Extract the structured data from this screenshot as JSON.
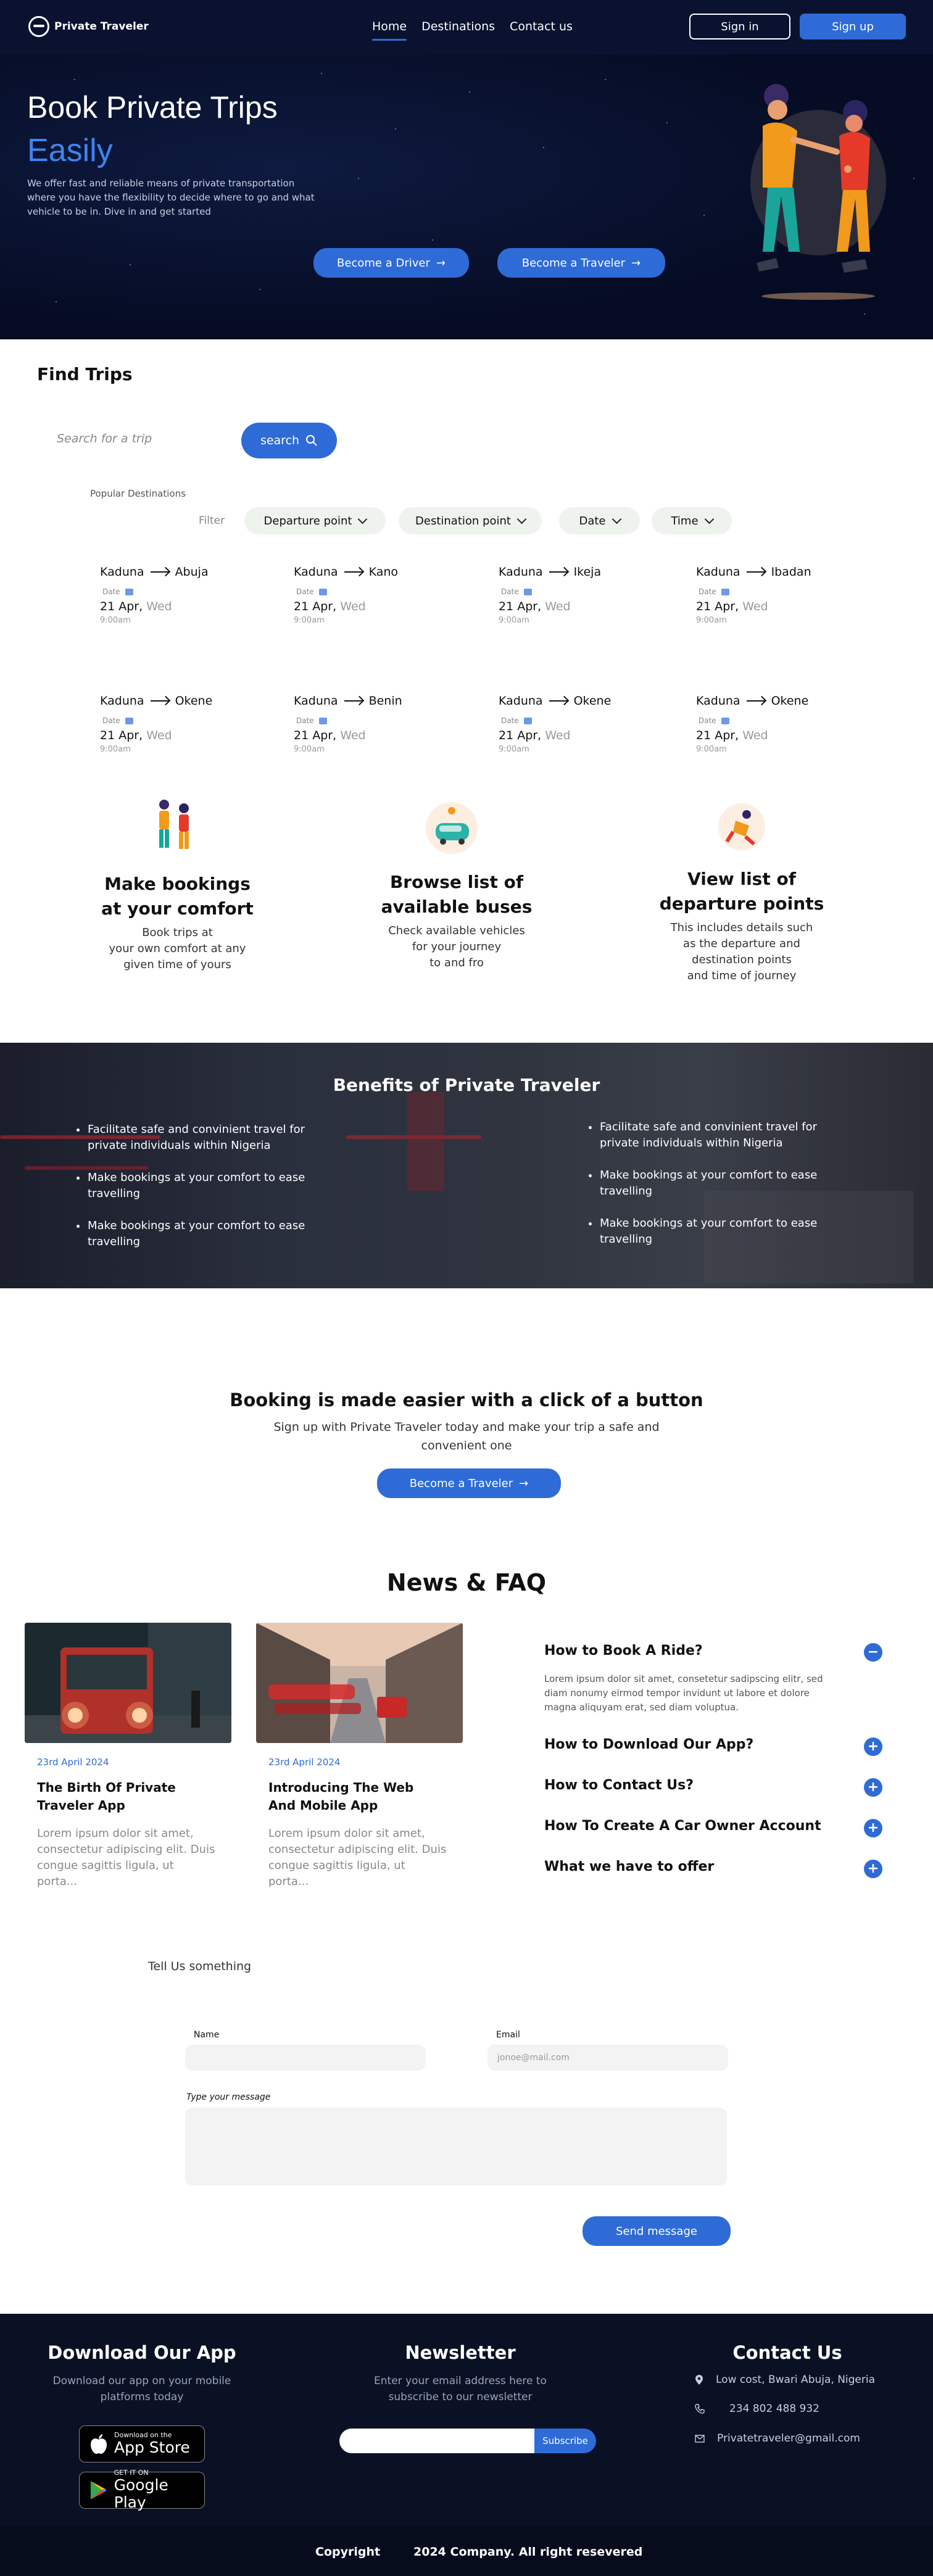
{
  "nav": {
    "brand": "Private Traveler",
    "links": [
      "Home",
      "Destinations",
      "Contact us"
    ],
    "signin": "Sign in",
    "signup": "Sign up"
  },
  "hero": {
    "title": "Book Private Trips",
    "accent": "Easily",
    "description": "We offer fast and reliable means of private transportation where you have the flexibility to decide where to go and what vehicle to be in. Dive in and get started",
    "driver_btn": "Become a Driver",
    "traveler_btn": "Become a Traveler"
  },
  "find": {
    "title": "Find Trips",
    "search_placeholder": "Search for a trip",
    "search_btn": "search",
    "popular": "Popular Destinations",
    "filter_label": "Filter",
    "filters": [
      "Departure point",
      "Destination point",
      "Date",
      "Time"
    ],
    "trips": [
      {
        "from": "Kaduna",
        "to": "Abuja",
        "date_label": "Date",
        "date": "21 Apr,",
        "day": "Wed",
        "time": "9:00am"
      },
      {
        "from": "Kaduna",
        "to": "Kano",
        "date_label": "Date",
        "date": "21 Apr,",
        "day": "Wed",
        "time": "9:00am"
      },
      {
        "from": "Kaduna",
        "to": "Ikeja",
        "date_label": "Date",
        "date": "21 Apr,",
        "day": "Wed",
        "time": "9:00am"
      },
      {
        "from": "Kaduna",
        "to": "Ibadan",
        "date_label": "Date",
        "date": "21 Apr,",
        "day": "Wed",
        "time": "9:00am"
      },
      {
        "from": "Kaduna",
        "to": "Okene",
        "date_label": "Date",
        "date": "21 Apr,",
        "day": "Wed",
        "time": "9:00am"
      },
      {
        "from": "Kaduna",
        "to": "Benin",
        "date_label": "Date",
        "date": "21 Apr,",
        "day": "Wed",
        "time": "9:00am"
      },
      {
        "from": "Kaduna",
        "to": "Okene",
        "date_label": "Date",
        "date": "21 Apr,",
        "day": "Wed",
        "time": "9:00am"
      },
      {
        "from": "Kaduna",
        "to": "Okene",
        "date_label": "Date",
        "date": "21 Apr,",
        "day": "Wed",
        "time": "9:00am"
      }
    ]
  },
  "features": [
    {
      "title": "Make bookings\nat your comfort",
      "text": "Book trips at\nyour own comfort at any\ngiven time of yours"
    },
    {
      "title": "Browse list of\navailable buses",
      "text": "Check available vehicles\nfor your journey\nto and fro"
    },
    {
      "title": "View list of\ndeparture points",
      "text": "This includes details such\nas the departure and\ndestination points\nand time of journey"
    }
  ],
  "benefits": {
    "title": "Benefits of Private Traveler",
    "left": [
      "Facilitate safe and convinient travel for private individuals within Nigeria",
      "Make bookings at your comfort to ease travelling",
      "Make bookings at your comfort to ease travelling"
    ],
    "right": [
      "Facilitate safe and convinient travel for private individuals within Nigeria",
      "Make bookings at your comfort to ease travelling",
      "Make bookings at your comfort to ease travelling"
    ]
  },
  "cta": {
    "title": "Booking is made easier with a click of a button",
    "text": "Sign up with Private Traveler today and make your trip a safe and convenient one",
    "btn": "Become a Traveler"
  },
  "news": {
    "title": "News & FAQ",
    "cards": [
      {
        "date": "23rd April 2024",
        "title": "The Birth Of Private Traveler App",
        "text": "Lorem ipsum dolor sit amet, consectetur adipiscing elit. Duis congue sagittis ligula, ut porta..."
      },
      {
        "date": "23rd April 2024",
        "title": "Introducing The Web And Mobile App",
        "text": "Lorem ipsum dolor sit amet, consectetur adipiscing elit. Duis congue sagittis ligula, ut porta..."
      }
    ],
    "faq": [
      {
        "q": "How to Book A Ride?",
        "open": true
      },
      {
        "q": "How to Download Our App?",
        "open": false
      },
      {
        "q": "How to Contact Us?",
        "open": false
      },
      {
        "q": "How To Create A Car Owner Account",
        "open": false
      },
      {
        "q": "What we have to offer",
        "open": false
      }
    ],
    "faq_answer": "Lorem ipsum dolor sit amet, consetetur sadipscing elitr, sed diam nonumy eirmod tempor invidunt ut labore et dolore magna aliquyam erat, sed diam voluptua."
  },
  "form": {
    "title": "Tell Us something",
    "name_label": "Name",
    "email_label": "Email",
    "email_placeholder": "jonoe@mail.com",
    "message_label": "Type your message",
    "send": "Send message"
  },
  "footer": {
    "app_title": "Download Our App",
    "app_text": "Download our app on your mobile platforms today",
    "appstore_small": "Download on the",
    "appstore_big": "App Store",
    "gplay_small": "GET IT ON",
    "gplay_big": "Google Play",
    "newsletter_title": "Newsletter",
    "newsletter_text": "Enter your email address here to subscribe to our newsletter",
    "subscribe": "Subscribe",
    "contact_title": "Contact Us",
    "address": "Low cost, Bwari Abuja, Nigeria",
    "phone": "234 802 488 932",
    "email": "Privatetraveler@gmail.com",
    "copyright": "Copyright",
    "company": "2024 Company. All right resevered"
  },
  "colors": {
    "accent": "#2e6bd6",
    "navy": "#0a1230",
    "footer": "#0a1124"
  }
}
